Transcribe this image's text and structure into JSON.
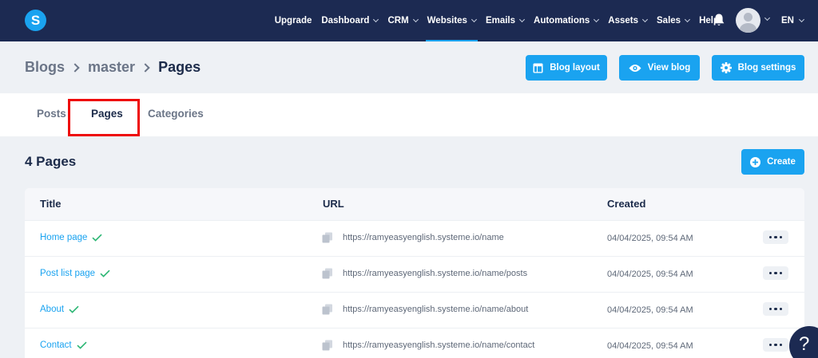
{
  "brand": {
    "logo_letter": "S"
  },
  "nav": {
    "items": [
      {
        "label": "Upgrade",
        "dropdown": false,
        "active": false
      },
      {
        "label": "Dashboard",
        "dropdown": true,
        "active": false
      },
      {
        "label": "CRM",
        "dropdown": true,
        "active": false
      },
      {
        "label": "Websites",
        "dropdown": true,
        "active": true
      },
      {
        "label": "Emails",
        "dropdown": true,
        "active": false
      },
      {
        "label": "Automations",
        "dropdown": true,
        "active": false
      },
      {
        "label": "Assets",
        "dropdown": true,
        "active": false
      },
      {
        "label": "Sales",
        "dropdown": true,
        "active": false
      },
      {
        "label": "Help",
        "dropdown": false,
        "active": false
      }
    ],
    "language": "EN"
  },
  "breadcrumb": {
    "items": [
      "Blogs",
      "master",
      "Pages"
    ]
  },
  "header_buttons": {
    "blog_layout": "Blog layout",
    "view_blog": "View blog",
    "blog_settings": "Blog settings"
  },
  "tabs": [
    {
      "label": "Posts",
      "active": false
    },
    {
      "label": "Pages",
      "active": true
    },
    {
      "label": "Categories",
      "active": false
    }
  ],
  "section": {
    "title": "4 Pages",
    "create_label": "Create"
  },
  "table": {
    "columns": [
      "Title",
      "URL",
      "Created"
    ],
    "rows": [
      {
        "title": "Home page",
        "url": "https://ramyeasyenglish.systeme.io/name",
        "created": "04/04/2025, 09:54 AM"
      },
      {
        "title": "Post list page",
        "url": "https://ramyeasyenglish.systeme.io/name/posts",
        "created": "04/04/2025, 09:54 AM"
      },
      {
        "title": "About",
        "url": "https://ramyeasyenglish.systeme.io/name/about",
        "created": "04/04/2025, 09:54 AM"
      },
      {
        "title": "Contact",
        "url": "https://ramyeasyenglish.systeme.io/name/contact",
        "created": "04/04/2025, 09:54 AM"
      }
    ]
  },
  "help": {
    "label": "?"
  },
  "colors": {
    "nav_bg": "#1c2a52",
    "accent": "#1aa3f0",
    "highlight": "#ee0a0a",
    "check": "#2bb673"
  }
}
